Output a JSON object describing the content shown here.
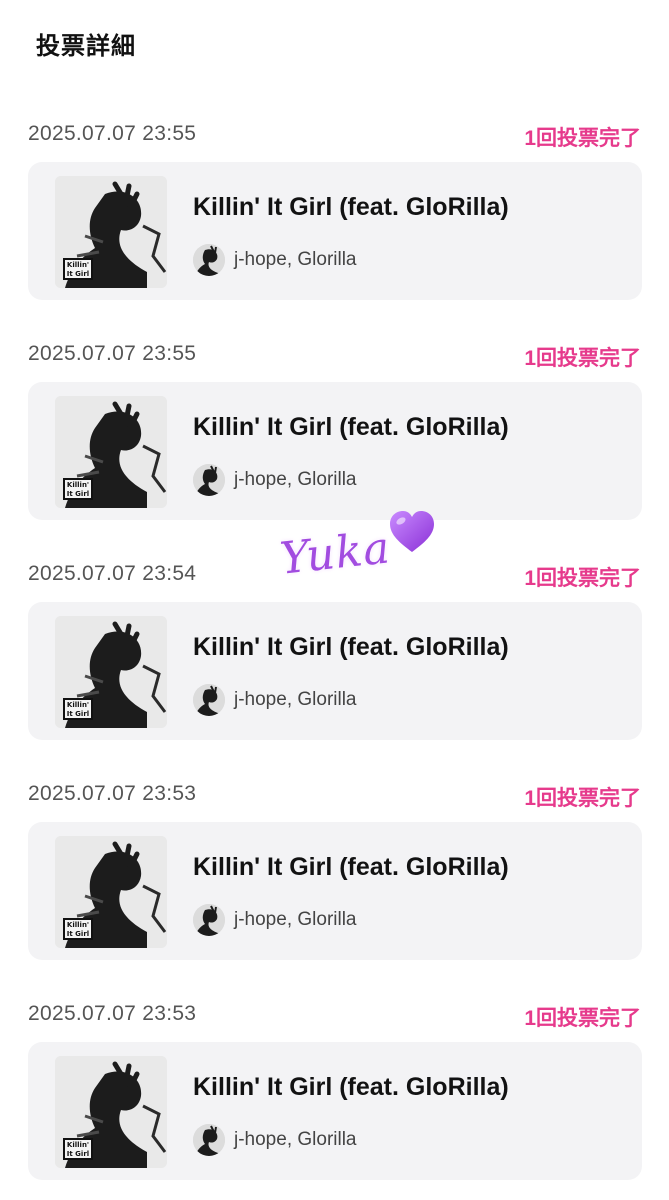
{
  "page": {
    "title": "投票詳細"
  },
  "votes": [
    {
      "time": "2025.07.07 23:55",
      "status": "1回投票完了",
      "track": {
        "title": "Killin' It Girl (feat. GloRilla)",
        "artists": "j-hope, Glorilla",
        "album_label": "Killin' It Girl"
      }
    },
    {
      "time": "2025.07.07 23:55",
      "status": "1回投票完了",
      "track": {
        "title": "Killin' It Girl (feat. GloRilla)",
        "artists": "j-hope, Glorilla",
        "album_label": "Killin' It Girl"
      }
    },
    {
      "time": "2025.07.07 23:54",
      "status": "1回投票完了",
      "track": {
        "title": "Killin' It Girl (feat. GloRilla)",
        "artists": "j-hope, Glorilla",
        "album_label": "Killin' It Girl"
      }
    },
    {
      "time": "2025.07.07 23:53",
      "status": "1回投票完了",
      "track": {
        "title": "Killin' It Girl (feat. GloRilla)",
        "artists": "j-hope, Glorilla",
        "album_label": "Killin' It Girl"
      }
    },
    {
      "time": "2025.07.07 23:53",
      "status": "1回投票完了",
      "track": {
        "title": "Killin' It Girl (feat. GloRilla)",
        "artists": "j-hope, Glorilla",
        "album_label": "Killin' It Girl"
      }
    }
  ],
  "overlay": {
    "signature": "Yuka",
    "icon": "purple-heart-icon"
  },
  "colors": {
    "status": "#e63a8c",
    "card_bg": "#f3f3f5",
    "signature": "#a24ce0"
  }
}
